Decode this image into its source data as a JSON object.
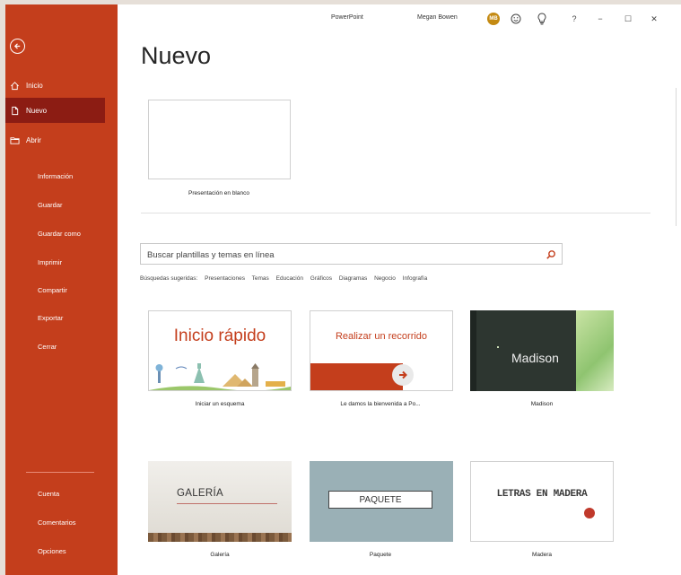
{
  "titlebar": {
    "app_title": "PowerPoint",
    "user_name": "Megan Bowen",
    "avatar_initials": "MB",
    "help_label": "?",
    "minimize_label": "−",
    "maximize_label": "☐",
    "close_label": "✕"
  },
  "sidebar": {
    "top_items": [
      {
        "label": "Inicio",
        "icon": "home-icon"
      },
      {
        "label": "Nuevo",
        "icon": "new-document-icon",
        "active": true
      },
      {
        "label": "Abrir",
        "icon": "open-folder-icon"
      }
    ],
    "items": [
      "Información",
      "Guardar",
      "Guardar como",
      "Imprimir",
      "Compartir",
      "Exportar",
      "Cerrar"
    ],
    "bottom_items": [
      "Cuenta",
      "Comentarios",
      "Opciones"
    ]
  },
  "main": {
    "title": "Nuevo",
    "blank": {
      "caption": "Presentación en blanco"
    },
    "search": {
      "placeholder": "Buscar plantillas y temas en línea",
      "value": ""
    },
    "suggested_label": "Búsquedas sugeridas:",
    "suggested": [
      "Presentaciones",
      "Temas",
      "Educación",
      "Gráficos",
      "Diagramas",
      "Negocio",
      "Infografía"
    ],
    "templates": [
      {
        "caption": "Iniciar un esquema",
        "thumb_text": "Inicio rápido"
      },
      {
        "caption": "Le damos la bienvenida a Po...",
        "thumb_text": "Realizar un recorrido"
      },
      {
        "caption": "Madison",
        "thumb_text": "Madison"
      },
      {
        "caption": "Galería",
        "thumb_text": "GALERÍA"
      },
      {
        "caption": "Paquete",
        "thumb_text": "PAQUETE"
      },
      {
        "caption": "Madera",
        "thumb_text": "LETRAS EN MADERA"
      }
    ]
  },
  "colors": {
    "sidebar": "#c43e1c",
    "sidebar_active": "#8c1c13",
    "accent": "#c43e1c"
  }
}
